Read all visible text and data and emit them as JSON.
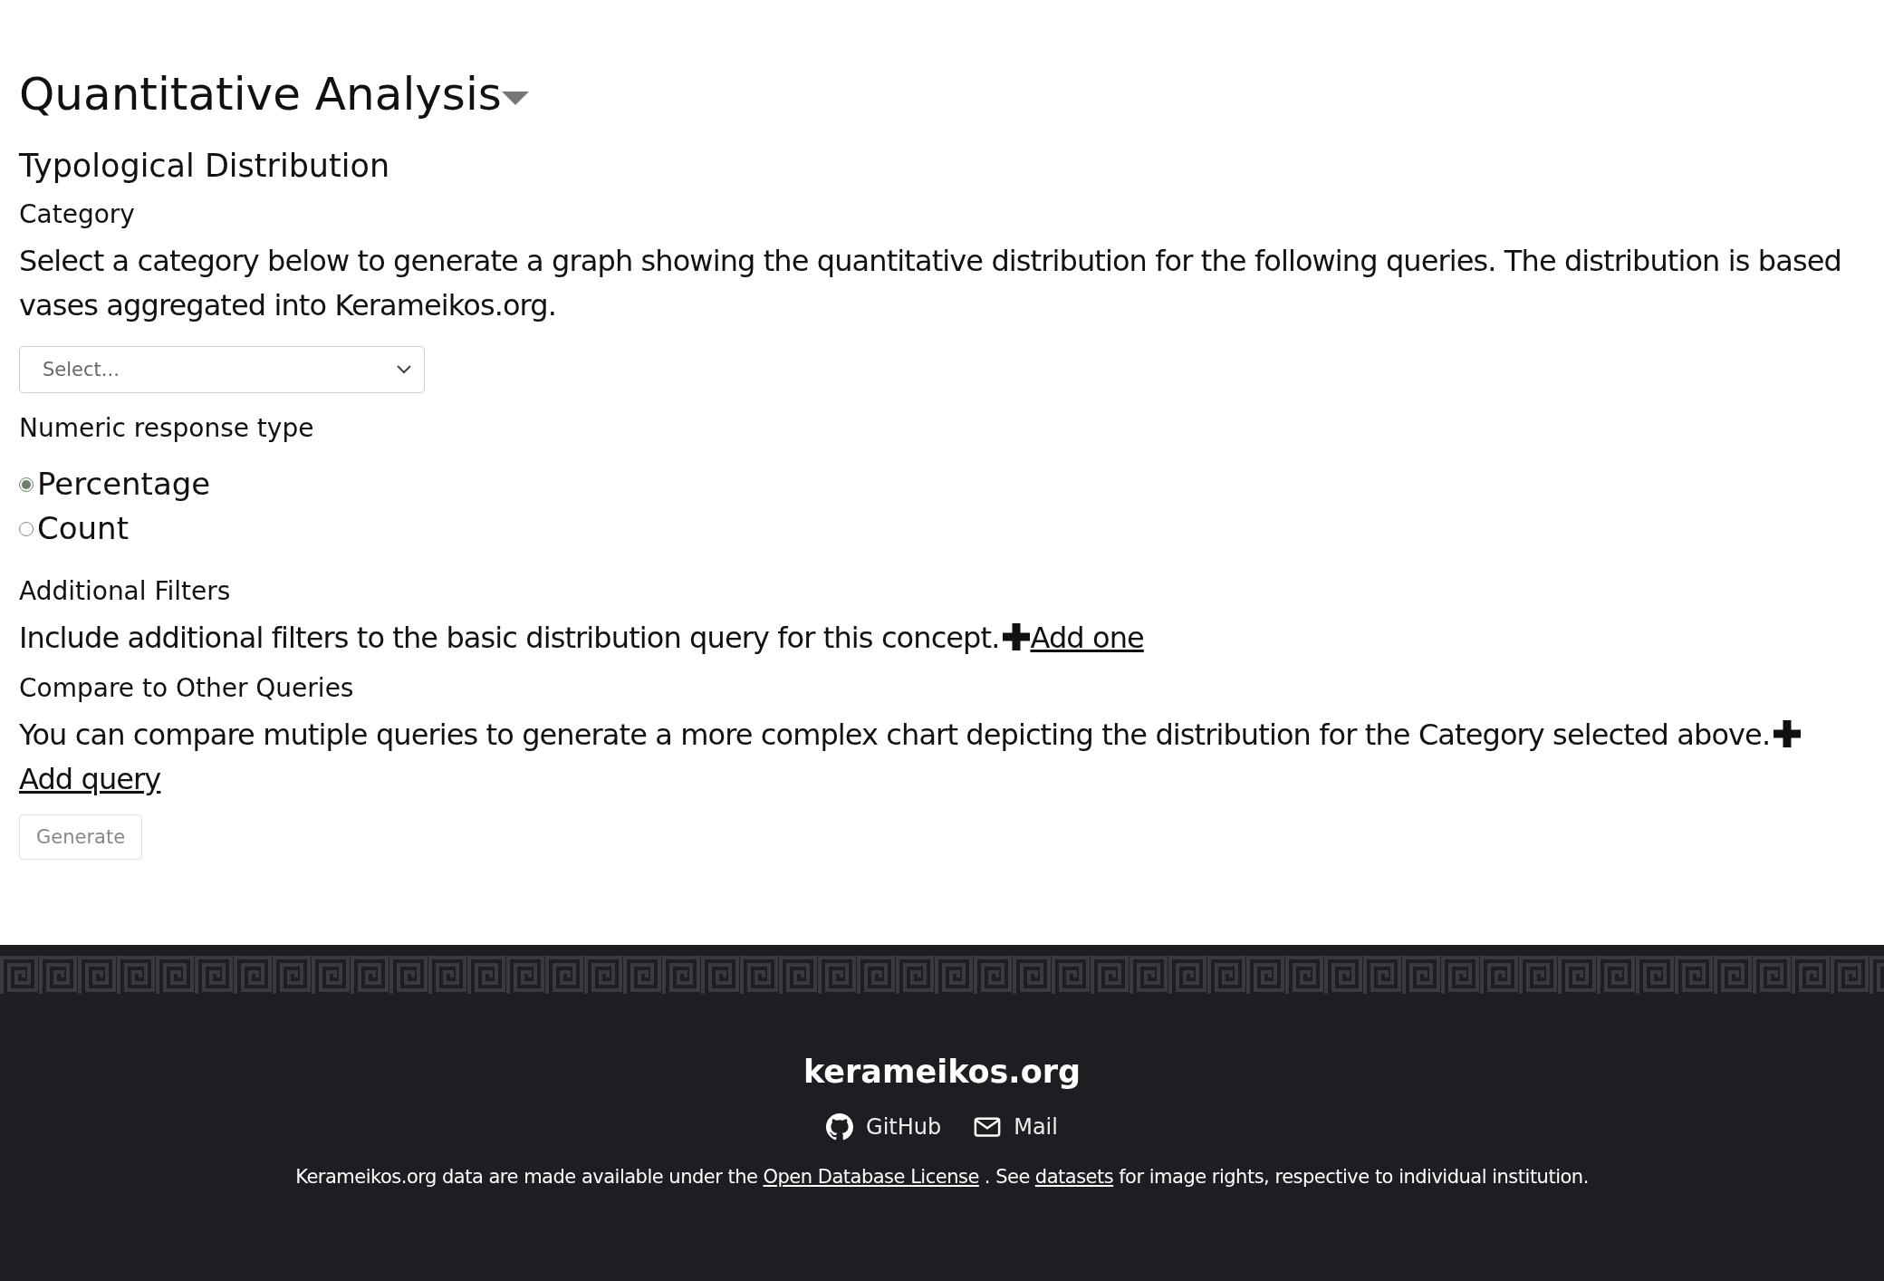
{
  "heading": {
    "title": "Quantitative Analysis",
    "expanded": true
  },
  "section_title": "Typological Distribution",
  "category": {
    "label": "Category",
    "description": "Select a category below to generate a graph showing the quantitative distribution for the following queries. The distribution is based vases aggregated into Kerameikos.org.",
    "select": {
      "placeholder": "Select..."
    }
  },
  "response_type": {
    "label": "Numeric response type",
    "options": [
      {
        "label": "Percentage",
        "selected": true
      },
      {
        "label": "Count",
        "selected": false
      }
    ]
  },
  "filters": {
    "label": "Additional Filters",
    "text": "Include additional filters to the basic distribution query for this concept.",
    "link": "Add one"
  },
  "compare": {
    "label": "Compare to Other Queries",
    "text": "You can compare mutiple queries to generate a more complex chart depicting the distribution for the Category selected above.",
    "link": "Add query"
  },
  "generate_button": {
    "label": "Generate",
    "disabled": true
  },
  "footer": {
    "title": "kerameikos.org",
    "links": [
      {
        "kind": "github",
        "label": "GitHub"
      },
      {
        "kind": "mail",
        "label": "Mail"
      }
    ],
    "license": {
      "before": "Kerameikos.org data are made available under the",
      "link1": "Open Database License",
      "middle": ". See",
      "link2": "datasets",
      "after": "for image rights, respective to individual institution."
    }
  }
}
